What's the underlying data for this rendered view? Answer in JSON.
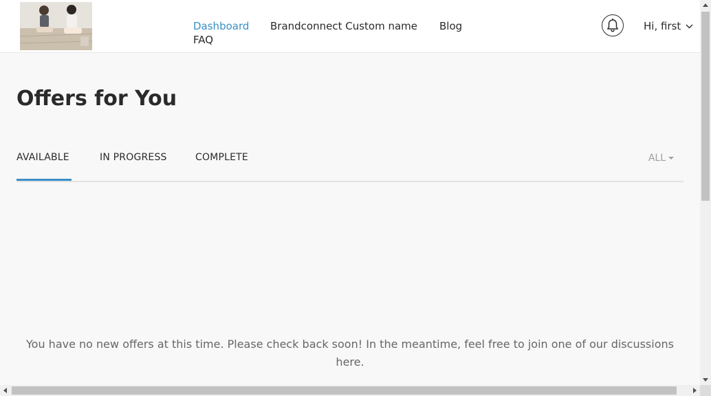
{
  "nav": {
    "links": [
      {
        "label": "Dashboard",
        "active": true
      },
      {
        "label": "Brandconnect Custom name",
        "active": false
      },
      {
        "label": "Blog",
        "active": false
      },
      {
        "label": "FAQ",
        "active": false
      }
    ]
  },
  "header": {
    "notifications_icon": "bell-icon",
    "user_greeting": "Hi, first",
    "user_menu_icon": "chevron-down-icon"
  },
  "main": {
    "title": "Offers for You",
    "tabs": [
      {
        "label": "AVAILABLE",
        "active": true
      },
      {
        "label": "IN PROGRESS",
        "active": false
      },
      {
        "label": "COMPLETE",
        "active": false
      }
    ],
    "filter": {
      "selected": "ALL"
    },
    "empty_message": "You have no new offers at this time. Please check back soon! In the meantime, feel free to join one of our discussions here."
  },
  "colors": {
    "accent": "#3a8fc8",
    "background": "#f8f8f8",
    "header_background": "#ffffff",
    "text": "#2a2a2a",
    "muted_text": "#666666"
  }
}
